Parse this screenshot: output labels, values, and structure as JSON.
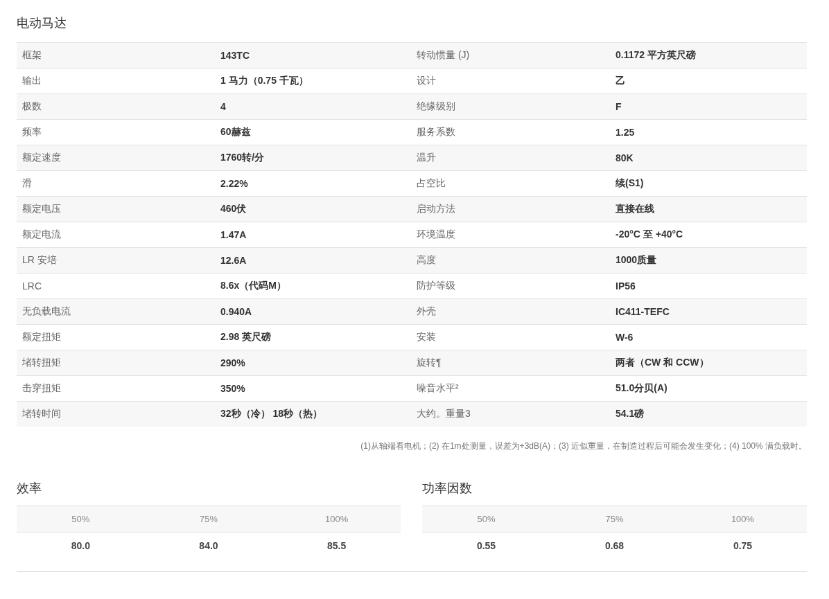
{
  "title": "电动马达",
  "specs": [
    {
      "label": "框架",
      "value": "143TC",
      "label_2": "转动惯量 (J)",
      "value_2": "0.1172 平方英尺磅"
    },
    {
      "label": "输出",
      "value": "1 马力（0.75 千瓦）",
      "label_2": "设计",
      "value_2": "乙"
    },
    {
      "label": "极数",
      "value": "4",
      "label_2": "绝缘级别",
      "value_2": "F"
    },
    {
      "label": "频率",
      "value": "60赫兹",
      "label_2": "服务系数",
      "value_2": "1.25"
    },
    {
      "label": "额定速度",
      "value": "1760转/分",
      "label_2": "温升",
      "value_2": "80K"
    },
    {
      "label": "滑",
      "value": "2.22%",
      "label_2": "占空比",
      "value_2": "续(S1)"
    },
    {
      "label": "额定电压",
      "value": "460伏",
      "label_2": "启动方法",
      "value_2": "直接在线"
    },
    {
      "label": "额定电流",
      "value": "1.47A",
      "label_2": "环境温度",
      "value_2": "-20°C 至 +40°C"
    },
    {
      "label": "LR 安培",
      "value": "12.6A",
      "label_2": "高度",
      "value_2": "1000质量"
    },
    {
      "label": "LRC",
      "value": "8.6x（代码M）",
      "label_2": "防护等级",
      "value_2": "IP56"
    },
    {
      "label": "无负载电流",
      "value": "0.940A",
      "label_2": "外壳",
      "value_2": "IC411-TEFC"
    },
    {
      "label": "额定扭矩",
      "value": "2.98 英尺磅",
      "label_2": "安装",
      "value_2": "W-6"
    },
    {
      "label": "堵转扭矩",
      "value": "290%",
      "label_2": "旋转¶",
      "value_2": "两者（CW 和 CCW）"
    },
    {
      "label": "击穿扭矩",
      "value": "350%",
      "label_2": "噪音水平²",
      "value_2": "51.0分贝(A)"
    },
    {
      "label": "堵转时间",
      "value": "32秒（冷） 18秒（热）",
      "label_2": "大约。重量3",
      "value_2": "54.1磅"
    }
  ],
  "footnote": "(1)从轴端看电机；(2) 在1m处测量，误差为+3dB(A)；(3) 近似重量，在制造过程后可能会发生变化；(4) 100% 满负载时。",
  "load_tables": [
    {
      "title": "效率",
      "columns": [
        "50%",
        "75%",
        "100%"
      ],
      "values": [
        "80.0",
        "84.0",
        "85.5"
      ]
    },
    {
      "title": "功率因数",
      "columns": [
        "50%",
        "75%",
        "100%"
      ],
      "values": [
        "0.55",
        "0.68",
        "0.75"
      ]
    }
  ]
}
